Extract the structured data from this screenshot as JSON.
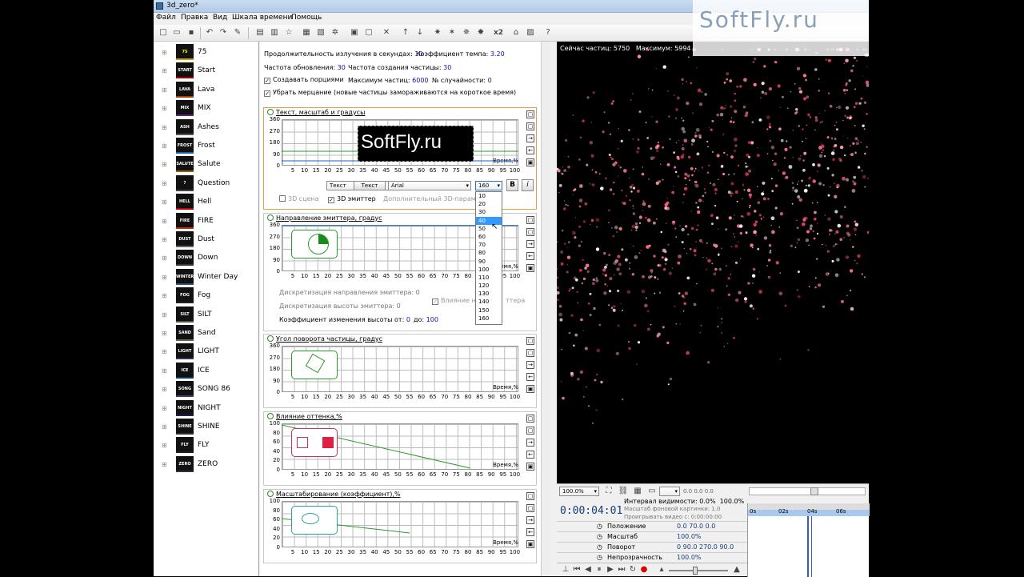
{
  "window": {
    "title": "3d_zero*"
  },
  "menu": [
    "Файл",
    "Правка",
    "Вид",
    "Шкала времени",
    "Помощь"
  ],
  "toolbar": {
    "zoom2x": "x2"
  },
  "presets": [
    "75",
    "Start",
    "Lava",
    "MIX",
    "Ashes",
    "Frost",
    "Salute",
    "Question",
    "Hell",
    "FIRE",
    "Dust",
    "Down",
    "Winter Day",
    "Fog",
    "SILT",
    "Sand",
    "LIGHT",
    "ICE",
    "SONG 86",
    "NIGHT",
    "SHINE",
    "FLY",
    "ZERO"
  ],
  "preset_thumbs": [
    "75",
    "START",
    "LAVA",
    "MIX",
    "ASH",
    "FROST",
    "SALUTE",
    "?",
    "HELL",
    "FIRE",
    "DUST",
    "DOWN",
    "WINTER",
    "FOG",
    "SILT",
    "SAND",
    "LIGHT",
    "ICE",
    "SONG",
    "NIGHT",
    "SHINE",
    "FLY",
    "ZERO"
  ],
  "params": {
    "emit_duration_label": "Продолжительность излучения в секундах:",
    "emit_duration": "10",
    "tempo_label": "Коэффициент темпа:",
    "tempo": "3.20",
    "refresh_label": "Частота обновления:",
    "refresh": "30",
    "creation_label": "Частота создания частицы:",
    "creation": "30",
    "batches_label": "Создавать порциями",
    "max_particles_label": "Максимум частиц:",
    "max_particles": "6000",
    "random_label": "№ случайности:",
    "random": "0",
    "flicker_label": "Убрать мерцание (новые частицы замораживаются на короткое время)"
  },
  "sections": [
    {
      "title": "Текст, масштаб и градусы",
      "y_ticks": [
        "360",
        "270",
        "180",
        "90",
        "0"
      ]
    },
    {
      "title": "Направление эмиттера, градус",
      "y_ticks": [
        "360",
        "270",
        "180",
        "90",
        "0"
      ]
    },
    {
      "title": "Угол поворота частицы, градус",
      "y_ticks": [
        "360",
        "270",
        "180",
        "90",
        "0"
      ]
    },
    {
      "title": "Влияние оттенка,%",
      "y_ticks": [
        "100",
        "80",
        "60",
        "40",
        "20",
        "0"
      ]
    },
    {
      "title": "Масштабирование (коэффициент),%",
      "y_ticks": [
        "100",
        "80",
        "60",
        "40",
        "20",
        "0"
      ]
    }
  ],
  "x_ticks": [
    "5",
    "10",
    "15",
    "20",
    "25",
    "30",
    "35",
    "40",
    "45",
    "50",
    "55",
    "60",
    "65",
    "70",
    "75",
    "80",
    "85",
    "90",
    "95",
    "100"
  ],
  "time_label": "Время,%",
  "text_controls": {
    "mode": "Текст",
    "button": "Текст",
    "font": "Arial",
    "size": "160",
    "bold": "B",
    "italic": "i",
    "scene3d": "3D сцена",
    "emitter3d": "3D эмиттер",
    "extra": "Дополнительный 3D-параметр"
  },
  "emitter_extra": {
    "dir_discr": "Дискретизация направления эмиттера: 0",
    "height_discr": "Дискретизация высоты эмиттера: 0",
    "influence": "Влияние на",
    "influence_rest": "ттера",
    "height_coef_label": "Коэффициент изменения высоты от:",
    "height_from": "0",
    "height_to_label": "до:",
    "height_to": "100"
  },
  "text_preview": "SoftFly.ru",
  "size_options": [
    "10",
    "20",
    "30",
    "40",
    "50",
    "60",
    "70",
    "80",
    "90",
    "100",
    "110",
    "120",
    "130",
    "140",
    "150",
    "160"
  ],
  "size_selected": "40",
  "preview": {
    "now_label": "Сейчас частиц:",
    "now": "5750",
    "max_label": "Максимум:",
    "max": "5994"
  },
  "bottom": {
    "zoom": "100.0%",
    "coords": "0.0  0.0  0.0",
    "timer": "0:00:04:01",
    "visibility_label": "Интервал видимости:",
    "vis_a": "0.0%",
    "vis_b": "100.0%",
    "bg_scale": "Масштаб фоновой картинки: 1.0",
    "video": "Проигрывать видео с: 0:00:00:00",
    "rows": [
      {
        "label": "Положение",
        "value": "0.0  70.0  0.0"
      },
      {
        "label": "Масштаб",
        "value": "100.0%"
      },
      {
        "label": "Поворот",
        "value": "0   90.0  270.0  90.0"
      },
      {
        "label": "Непрозрачность",
        "value": "100.0%"
      }
    ],
    "ticks": [
      "0s",
      "02s",
      "04s",
      "06s"
    ]
  },
  "watermark": "SoftFly.ru"
}
